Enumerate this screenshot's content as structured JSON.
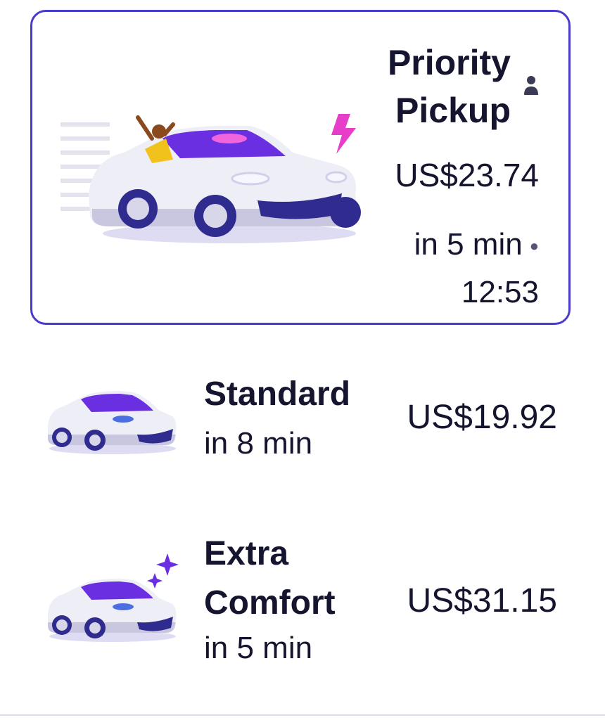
{
  "priority": {
    "title_line1": "Priority",
    "title_line2": "Pickup",
    "price": "US$23.74",
    "eta": "in 5 min",
    "time": "12:53",
    "icons": [
      "car-illustration",
      "lightning-icon",
      "person-icon"
    ]
  },
  "options": [
    {
      "name": "Standard",
      "eta": "in 8 min",
      "price": "US$19.92",
      "icon": "car-illustration"
    },
    {
      "name_line1": "Extra",
      "name_line2": "Comfort",
      "eta": "in 5 min",
      "price": "US$31.15",
      "icon": "car-sparkle-illustration"
    }
  ],
  "colors": {
    "accent": "#4a3bcf",
    "text": "#151530",
    "lightning": "#e63ec9",
    "car_window": "#6a2fe0"
  }
}
